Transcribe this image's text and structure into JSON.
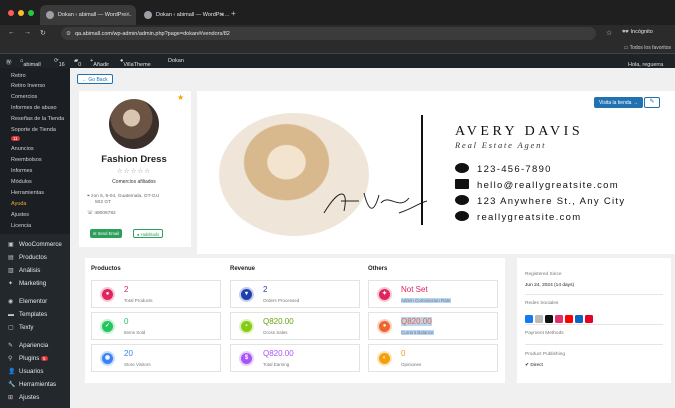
{
  "browser": {
    "tabs": [
      {
        "title": "Dokan ‹ abimall — WordPre…"
      },
      {
        "title": "Dokan ‹ abimall — WordPre…"
      }
    ],
    "url": "qa.abimall.com/wp-admin/admin.php?page=dokan#/vendors/82",
    "incognito_label": "Incógnito",
    "all_bookmarks_label": "Todos los favoritos"
  },
  "wp_admin_bar": {
    "site_name": "abimall",
    "updates_count": "16",
    "comments_count": "0",
    "add_new": "Añadir",
    "theme_link": "VillaTheme",
    "plugin_link": "Dokan",
    "greeting": "Hola, reguerra"
  },
  "sidebar": {
    "submenu": [
      "Retiro",
      "Retiro Inverso",
      "Comercios",
      "Informes de abuso",
      "Reseñas de la Tienda",
      "Soporte de Tienda",
      "Anuncios",
      "Reembolsos",
      "Informes",
      "Módulos",
      "Herramientas",
      "Ayuda",
      "Ajustes",
      "Licencia"
    ],
    "support_badge": "11",
    "active_item": "Ayuda",
    "main": [
      {
        "label": "WooCommerce",
        "icon": "woocommerce-icon"
      },
      {
        "label": "Productos",
        "icon": "products-icon"
      },
      {
        "label": "Análisis",
        "icon": "analytics-icon"
      },
      {
        "label": "Marketing",
        "icon": "marketing-icon"
      },
      {
        "label": "Elementor",
        "icon": "elementor-icon"
      },
      {
        "label": "Templates",
        "icon": "templates-icon"
      },
      {
        "label": "Texty",
        "icon": "texty-icon"
      },
      {
        "label": "Apariencia",
        "icon": "appearance-icon"
      },
      {
        "label": "Plugins",
        "icon": "plugins-icon"
      },
      {
        "label": "Usuarios",
        "icon": "users-icon"
      },
      {
        "label": "Herramientas",
        "icon": "tools-icon"
      },
      {
        "label": "Ajustes",
        "icon": "settings-icon"
      }
    ],
    "plugins_badge": "5"
  },
  "vendor": {
    "go_back_label": "← Go Back",
    "store_name": "Fashion Dress",
    "rating_stars": "☆☆☆☆☆",
    "category": "Comercios afiliados",
    "address_line1": "zon 5, 5-04, Guatemala, GT-GU",
    "address_line2": "502 GT",
    "phone": "49006782",
    "send_email_label": "Send Email",
    "verified_label": "Habilitado"
  },
  "banner": {
    "name": "AVERY DAVIS",
    "role": "Real Estate Agent",
    "phone": "123-456-7890",
    "email": "hello@reallygreatsite.com",
    "address": "123 Anywhere St., Any City",
    "website": "reallygreatsite.com",
    "visit_store_label": "Visita la tienda →",
    "signature": "Avery Davis"
  },
  "stats": {
    "columns": [
      "Productos",
      "Revenue",
      "Others"
    ],
    "products": [
      {
        "value": "2",
        "label": "Total Products",
        "color": "#e0245e"
      },
      {
        "value": "0",
        "label": "Items Sold",
        "color": "#22c55e"
      },
      {
        "value": "20",
        "label": "Store Visitors",
        "color": "#3b82f6"
      }
    ],
    "revenue": [
      {
        "value": "2",
        "label": "Orders Processed",
        "color": "#1e40af"
      },
      {
        "value": "Q820.00",
        "label": "Gross Sales",
        "color": "#84cc16"
      },
      {
        "value": "Q820.00",
        "label": "Total Earning",
        "color": "#a855f7"
      }
    ],
    "others": [
      {
        "value": "Not Set",
        "label": "Admin Commission Rate",
        "color": "#e0245e"
      },
      {
        "value": "Q820.00",
        "label": "Current Balance",
        "color": "#f0642e"
      },
      {
        "value": "0",
        "label": "Opiniones",
        "color": "#f59e0b"
      }
    ]
  },
  "info": {
    "registered_title": "Registered Since",
    "registered_value": "Jun 24, 2024 (14 days)",
    "social_title": "Redes Sociales",
    "payment_title": "Payment Methods",
    "publishing_title": "Product Publishing",
    "publishing_value": "Direct"
  }
}
